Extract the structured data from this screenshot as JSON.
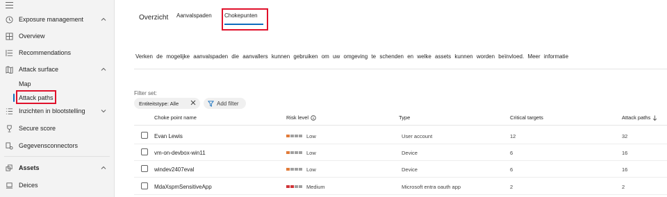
{
  "sidebar": {
    "items": [
      {
        "label": "Exposure management",
        "icon": "clock-icon",
        "expanded": true
      },
      {
        "label": "Overview",
        "icon": "grid-icon"
      },
      {
        "label": "Recommendations",
        "icon": "list-icon"
      },
      {
        "label": "Attack surface",
        "icon": "map-icon",
        "expanded": true
      },
      {
        "label": "Map"
      },
      {
        "label": "Attack paths",
        "active": true
      },
      {
        "label": "Inzichten in blootstelling",
        "icon": "list-lines-icon"
      },
      {
        "label": "Secure score",
        "icon": "trophy-icon"
      },
      {
        "label": "Gegevensconnectors",
        "icon": "connector-icon"
      },
      {
        "label": "Assets",
        "icon": "assets-icon",
        "expanded": true
      },
      {
        "label": "Deices",
        "icon": "device-icon"
      }
    ]
  },
  "tabs": [
    {
      "label": "Overzicht"
    },
    {
      "label": "Aanvalspaden"
    },
    {
      "label": "Chokepunten",
      "selected": true
    }
  ],
  "description": "Verken de mogelijke aanvalspaden die aanvallers kunnen gebruiken om uw omgeving te schenden en welke assets kunnen worden beïnvloed. Meer informatie",
  "filters": {
    "label": "Filter set:",
    "chip": "Entiteitstype: Alle",
    "add_filter": "Add filter"
  },
  "table": {
    "columns": [
      "Choke point name",
      "Risk level",
      "Type",
      "Critical targets",
      "Attack paths"
    ],
    "sort_column": "Attack paths",
    "rows": [
      {
        "name": "Evan Lewis",
        "risk": "Low",
        "risk_level": 1,
        "type": "User account",
        "critical_targets": "12",
        "attack_paths": "32"
      },
      {
        "name": "vm-on-devbox-win11",
        "risk": "Low",
        "risk_level": 1,
        "type": "Device",
        "critical_targets": "6",
        "attack_paths": "16"
      },
      {
        "name": "windev2407eval",
        "risk": "Low",
        "risk_level": 1,
        "type": "Device",
        "critical_targets": "6",
        "attack_paths": "16"
      },
      {
        "name": "MdaXspmSensitiveApp",
        "risk": "Medium",
        "risk_level": 2,
        "type": "Microsoft entra oauth app",
        "critical_targets": "2",
        "attack_paths": "2"
      }
    ]
  },
  "colors": {
    "accent": "#0f6cbd",
    "highlight_box": "#e0102a",
    "risk_low": "#e07b39",
    "risk_medium": "#d13438",
    "risk_empty": "#a0a0a0"
  }
}
